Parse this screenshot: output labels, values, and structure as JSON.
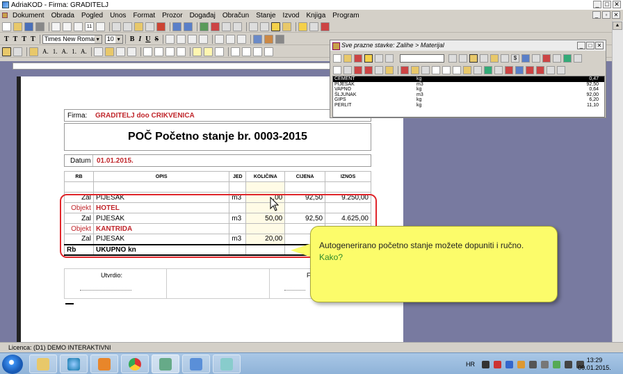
{
  "window": {
    "title": "AdriaKOD - Firma: GRADITELJ"
  },
  "menu": [
    "Dokument",
    "Obrada",
    "Pogled",
    "Unos",
    "Format",
    "Prozor",
    "Događaj",
    "Obračun",
    "Stanje",
    "Izvod",
    "Knjiga",
    "Program"
  ],
  "format_toolbar": {
    "font_name": "Times New Roman",
    "font_size": "10",
    "style_letters": [
      "T",
      "T",
      "T",
      "T"
    ],
    "bold": "B",
    "italic": "I",
    "underline": "U",
    "strike": "S"
  },
  "toolbar_text": [
    "A.",
    "1.",
    "A.",
    "1.",
    "A."
  ],
  "document": {
    "firma_label": "Firma:",
    "firma_value": "GRADITELJ doo CRIKVENICA",
    "heading": "POČ Početno stanje br. 0003-2015",
    "datum_label": "Datum",
    "datum_value": "01.01.2015.",
    "columns": [
      "RB",
      "OPIS",
      "JED",
      "KOLIČINA",
      "CIJENA",
      "IZNOS"
    ],
    "rows": [
      {
        "rb": "Zal",
        "opis": "PIJESAK",
        "jed": "m3",
        "kolicina": ",00",
        "cijena": "92,50",
        "iznos": "9.250,00",
        "type": "item"
      },
      {
        "rb": "Objekt",
        "opis": "HOTEL",
        "type": "object"
      },
      {
        "rb": "Zal",
        "opis": "PIJESAK",
        "jed": "m3",
        "kolicina": "50,00",
        "cijena": "92,50",
        "iznos": "4.625,00",
        "type": "item"
      },
      {
        "rb": "Objekt",
        "opis": "KANTRIDA",
        "type": "object"
      },
      {
        "rb": "Zal",
        "opis": "PIJESAK",
        "jed": "m3",
        "kolicina": "20,00",
        "cijena": "",
        "iznos": "",
        "type": "item"
      }
    ],
    "total_rb": "Rb",
    "total_label": "UKUPNO kn",
    "sign_label": "Utvrdio:",
    "sign_label2": "F"
  },
  "callout": {
    "text": "Autogenerirano početno stanje možete dopuniti i ručno.",
    "link": "Kako?"
  },
  "floating_window": {
    "title": "Sve prazne stavke:  Zalihe > Materijal",
    "items": [
      {
        "name": "CEMENT",
        "unit": "kg",
        "price": "0,47",
        "selected": true
      },
      {
        "name": "PIJESAK",
        "unit": "m3",
        "price": "92,50"
      },
      {
        "name": "VAPNO",
        "unit": "kg",
        "price": "0,64"
      },
      {
        "name": "ŠLJUNAK",
        "unit": "m3",
        "price": "92,00"
      },
      {
        "name": "GIPS",
        "unit": "kg",
        "price": "6,20"
      },
      {
        "name": "PERLIT",
        "unit": "kg",
        "price": "11,10"
      }
    ]
  },
  "status": {
    "text": "Licenca: (D1) DEMO INTERAKTIVNI"
  },
  "taskbar": {
    "lang": "HR",
    "time": "13:29",
    "date": "09.01.2015."
  }
}
